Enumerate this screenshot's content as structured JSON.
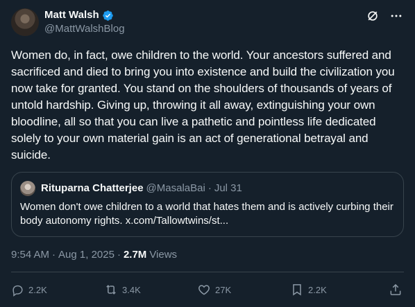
{
  "author": {
    "name": "Matt Walsh",
    "handle": "@MattWalshBlog",
    "verified": true
  },
  "tweet": {
    "text": "Women do, in fact, owe children to the world. Your ancestors suffered and sacrificed and died to bring you into existence and build the civilization you now take for granted. You stand on the shoulders of thousands of years of untold hardship. Giving up, throwing it all away, extinguishing your own bloodline, all so that you can live a pathetic and pointless life dedicated solely to your own material gain is an act of generational betrayal and suicide."
  },
  "quote": {
    "name": "Rituparna Chatterjee",
    "handle": "@MasalaBai",
    "separator": "·",
    "date": "Jul 31",
    "text": "Women don't owe children to a world that hates them and is actively curbing their body autonomy rights. x.com/Tallowtwins/st..."
  },
  "meta": {
    "time": "9:54 AM",
    "dot1": "·",
    "date": "Aug 1, 2025",
    "dot2": "·",
    "views_count": "2.7M",
    "views_label": "Views"
  },
  "actions": {
    "replies": "2.2K",
    "reposts": "3.4K",
    "likes": "27K",
    "bookmarks": "2.2K"
  },
  "colors": {
    "background": "#15202b",
    "text": "#f7f9f9",
    "secondary": "#8b98a5",
    "border": "#38444d",
    "verified": "#1d9bf0"
  },
  "icons": [
    "verified-badge-icon",
    "grok-icon",
    "more-icon",
    "reply-icon",
    "repost-icon",
    "like-icon",
    "bookmark-icon",
    "share-icon"
  ]
}
